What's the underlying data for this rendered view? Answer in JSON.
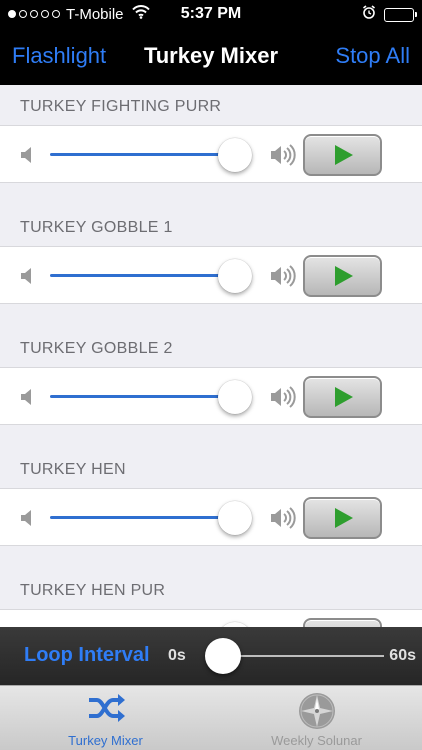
{
  "status_bar": {
    "carrier": "T-Mobile",
    "time": "5:37 PM"
  },
  "nav": {
    "left_button": "Flashlight",
    "title": "Turkey Mixer",
    "right_button": "Stop All"
  },
  "sounds": [
    {
      "name": "TURKEY FIGHTING PURR",
      "volume": 1.0
    },
    {
      "name": "TURKEY GOBBLE 1",
      "volume": 1.0
    },
    {
      "name": "TURKEY GOBBLE 2",
      "volume": 1.0
    },
    {
      "name": "TURKEY HEN",
      "volume": 1.0
    },
    {
      "name": "TURKEY HEN PUR",
      "volume": 1.0
    }
  ],
  "loop_interval": {
    "label": "Loop Interval",
    "min_label": "0s",
    "max_label": "60s",
    "value_seconds": 0
  },
  "tabs": [
    {
      "label": "Turkey Mixer",
      "icon": "shuffle-icon",
      "selected": true
    },
    {
      "label": "Weekly Solunar",
      "icon": "compass-icon",
      "selected": false
    }
  ],
  "colors": {
    "accent": "#2f7df6",
    "slider_fill": "#2f6fd0",
    "play_green": "#2e9e2e"
  }
}
